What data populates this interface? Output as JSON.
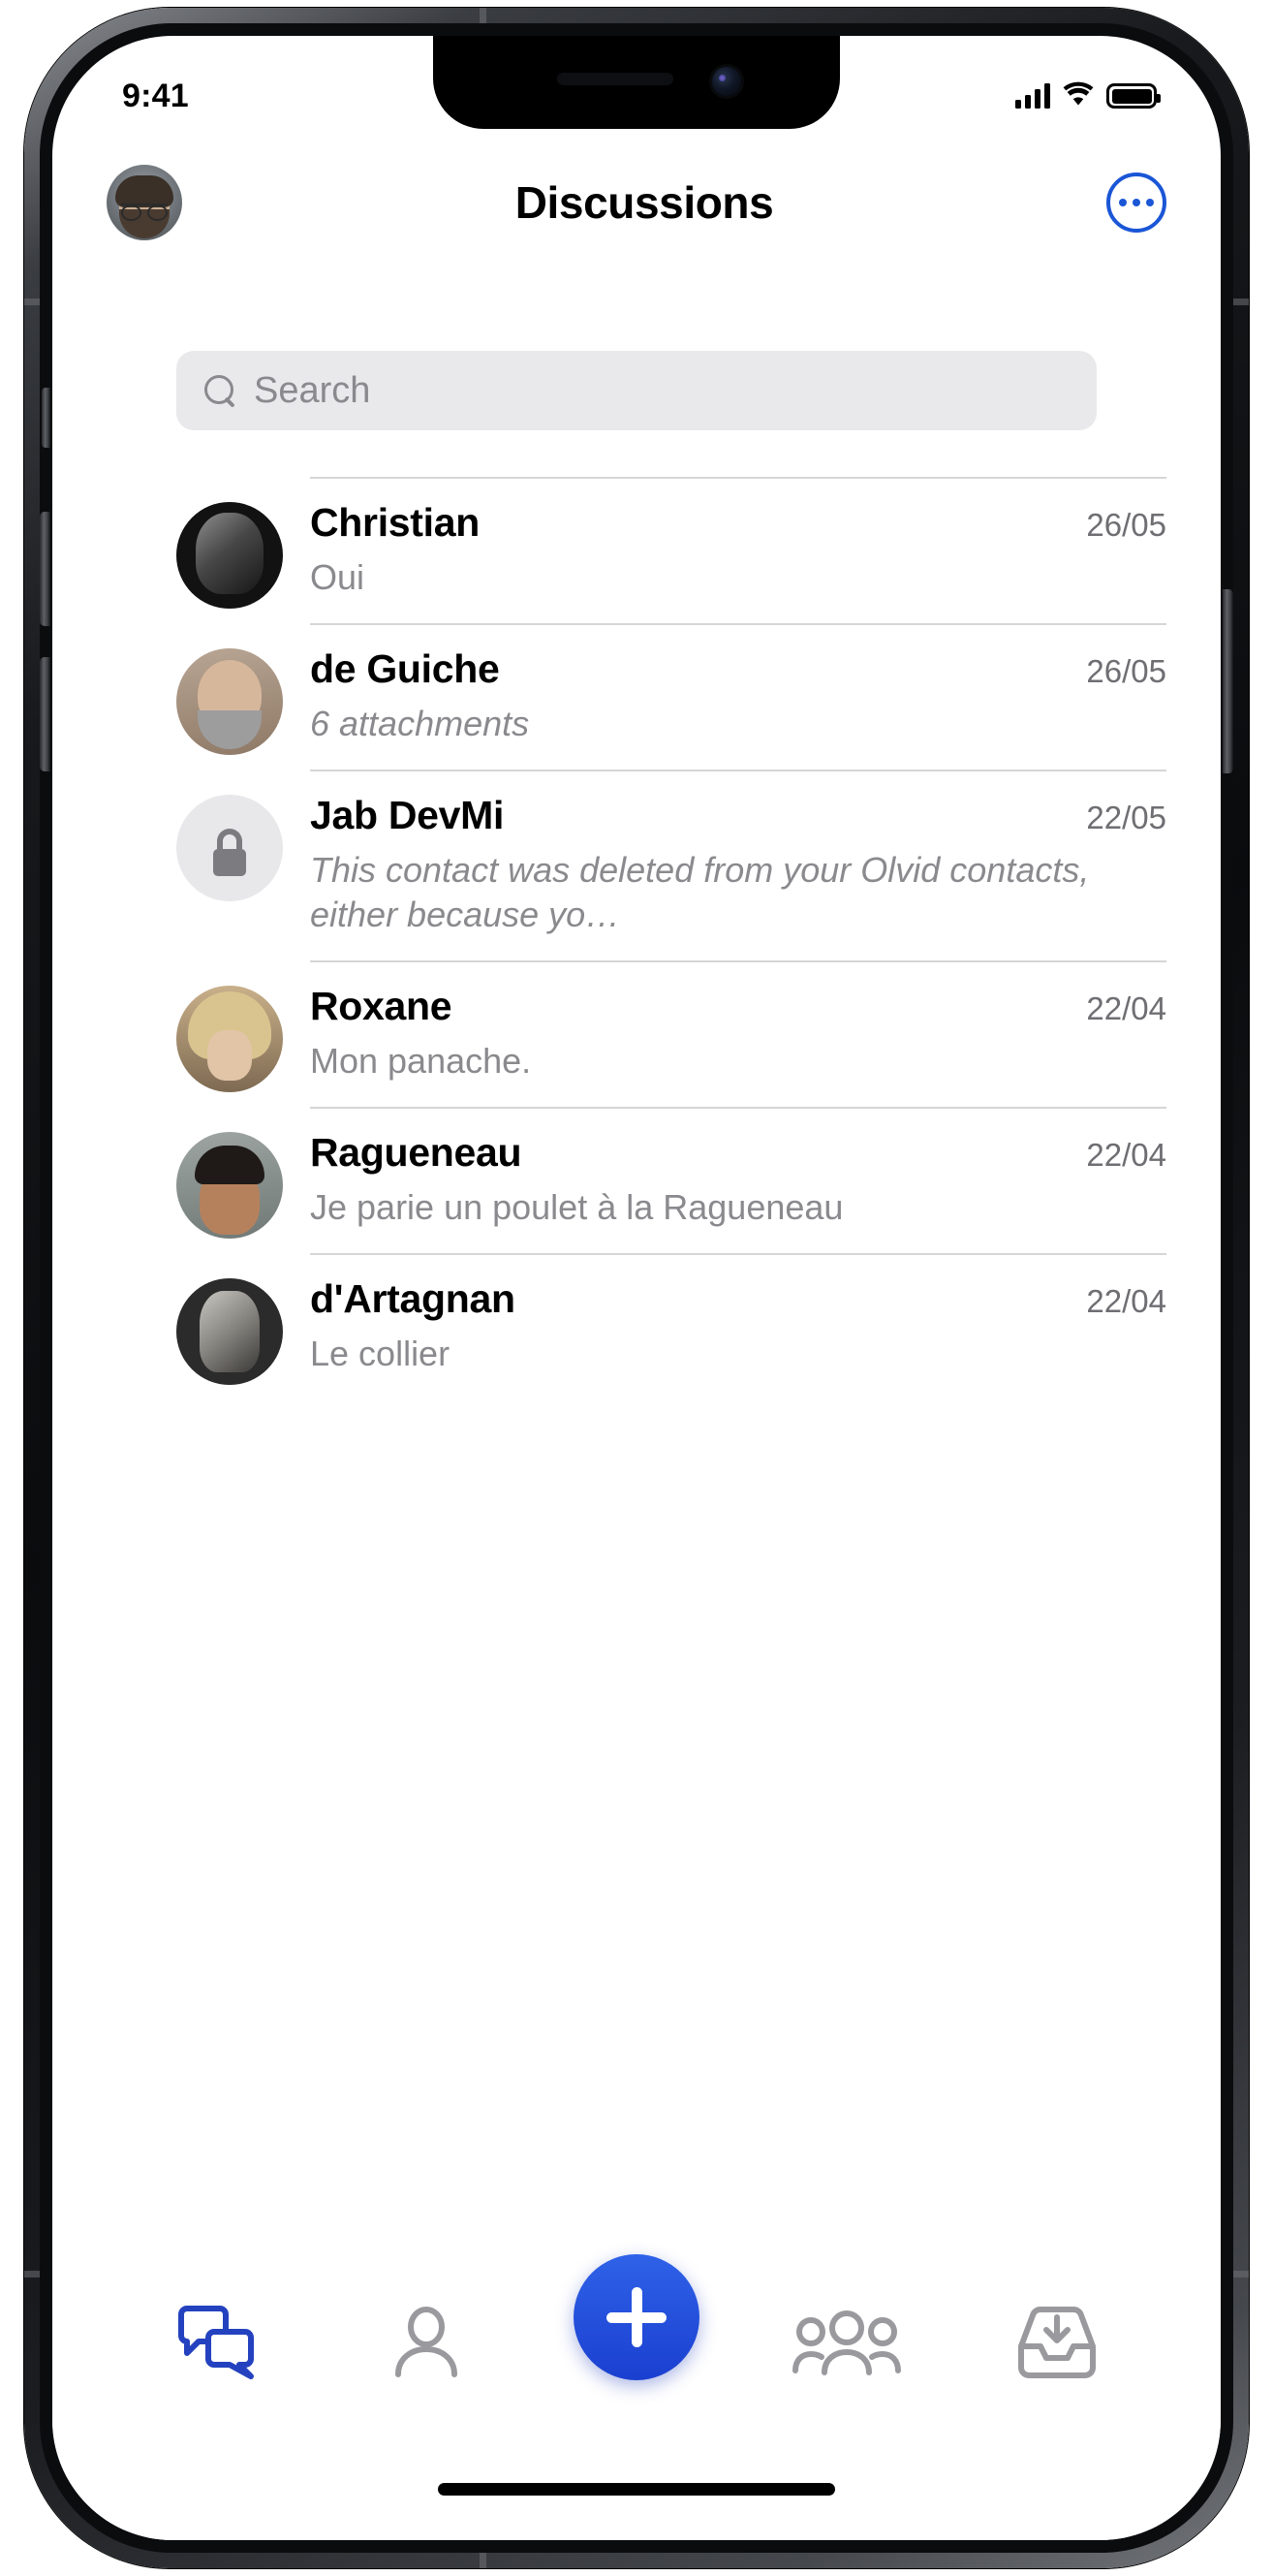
{
  "theme": {
    "accent": "#1a3fd0",
    "accent_icon": "#1a56d6",
    "background": "#ffffff",
    "search_background": "#e9e9eb",
    "secondary_text": "#8a8a8e",
    "date_text": "#6e6e73",
    "separator": "#d6d6d8"
  },
  "status_bar": {
    "time": "9:41",
    "cellular_icon": "cellular-bars-icon",
    "wifi_icon": "wifi-icon",
    "battery_icon": "battery-full-icon"
  },
  "header": {
    "owner_avatar_icon": "owner-avatar",
    "title": "Discussions",
    "more_button_icon": "ellipsis-circle-icon"
  },
  "search": {
    "icon": "search-icon",
    "placeholder": "Search",
    "value": ""
  },
  "conversations": [
    {
      "name": "Christian",
      "date": "26/05",
      "preview": "Oui",
      "italic": false,
      "avatar_style": "av-dark",
      "avatar_icon": "contact-avatar-christian"
    },
    {
      "name": "de Guiche",
      "date": "26/05",
      "preview": "6 attachments",
      "italic": true,
      "avatar_style": "av-bald",
      "avatar_icon": "contact-avatar-de-guiche"
    },
    {
      "name": "Jab DevMi",
      "date": "22/05",
      "preview": "This contact was deleted from your Olvid contacts, either because yo…",
      "italic": true,
      "avatar_style": "av-lock",
      "avatar_icon": "lock-avatar-icon"
    },
    {
      "name": "Roxane",
      "date": "22/04",
      "preview": "Mon panache.",
      "italic": false,
      "avatar_style": "av-blonde",
      "avatar_icon": "contact-avatar-roxane"
    },
    {
      "name": "Ragueneau",
      "date": "22/04",
      "preview": "Je parie un poulet à la Ragueneau",
      "italic": false,
      "avatar_style": "av-man2",
      "avatar_icon": "contact-avatar-ragueneau"
    },
    {
      "name": "d'Artagnan",
      "date": "22/04",
      "preview": "Le collier",
      "italic": false,
      "avatar_style": "av-statue",
      "avatar_icon": "contact-avatar-dartagnan"
    }
  ],
  "tab_bar": {
    "items": [
      {
        "icon": "discussions-icon",
        "active": true
      },
      {
        "icon": "contacts-person-icon",
        "active": false
      },
      {
        "icon": "groups-people-icon",
        "active": false
      },
      {
        "icon": "invitations-tray-icon",
        "active": false
      }
    ],
    "compose_button_icon": "plus-icon"
  }
}
